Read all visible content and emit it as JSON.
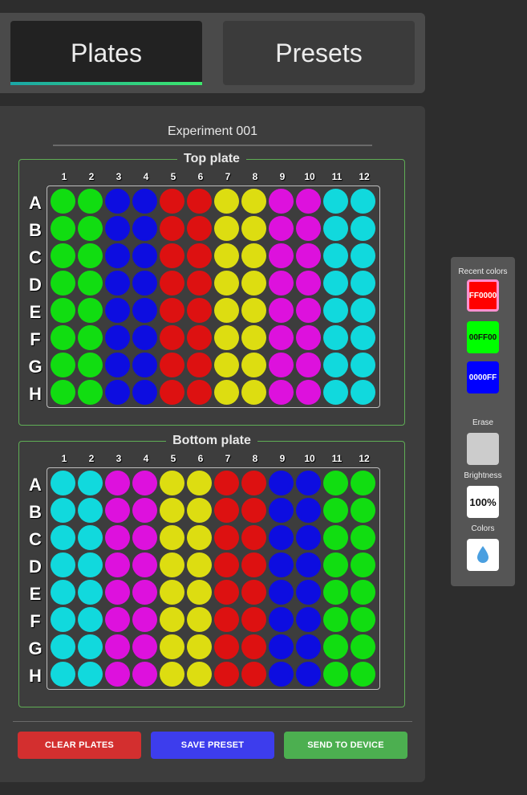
{
  "tabs": {
    "plates": "Plates",
    "presets": "Presets"
  },
  "experiment": {
    "title": "Experiment 001"
  },
  "columns": [
    "1",
    "2",
    "3",
    "4",
    "5",
    "6",
    "7",
    "8",
    "9",
    "10",
    "11",
    "12"
  ],
  "rows": [
    "A",
    "B",
    "C",
    "D",
    "E",
    "F",
    "G",
    "H"
  ],
  "colors": {
    "green": "#11dd11",
    "blue": "#0d0de0",
    "red": "#dd1111",
    "yellow": "#dddd11",
    "magenta": "#dd11dd",
    "cyan": "#11d9dd"
  },
  "plates": {
    "top": {
      "label": "Top plate",
      "column_colors": [
        "green",
        "green",
        "blue",
        "blue",
        "red",
        "red",
        "yellow",
        "yellow",
        "magenta",
        "magenta",
        "cyan",
        "cyan"
      ]
    },
    "bottom": {
      "label": "Bottom plate",
      "column_colors": [
        "cyan",
        "cyan",
        "magenta",
        "magenta",
        "yellow",
        "yellow",
        "red",
        "red",
        "blue",
        "blue",
        "green",
        "green"
      ]
    }
  },
  "actions": {
    "clear": {
      "label": "CLEAR PLATES",
      "color": "#d32f2f"
    },
    "save": {
      "label": "SAVE PRESET",
      "color": "#3d3ded"
    },
    "send": {
      "label": "SEND TO DEVICE",
      "color": "#4caf50"
    }
  },
  "side": {
    "recent_label": "Recent colors",
    "recent": [
      {
        "hex": "FF0000",
        "color": "#ff0000",
        "selected": true
      },
      {
        "hex": "00FF00",
        "color": "#00ff00",
        "selected": false
      },
      {
        "hex": "0000FF",
        "color": "#0000ff",
        "selected": false
      }
    ],
    "erase_label": "Erase",
    "brightness_label": "Brightness",
    "brightness_value": "100%",
    "colors_label": "Colors",
    "colors_icon": "water-drop-icon"
  }
}
